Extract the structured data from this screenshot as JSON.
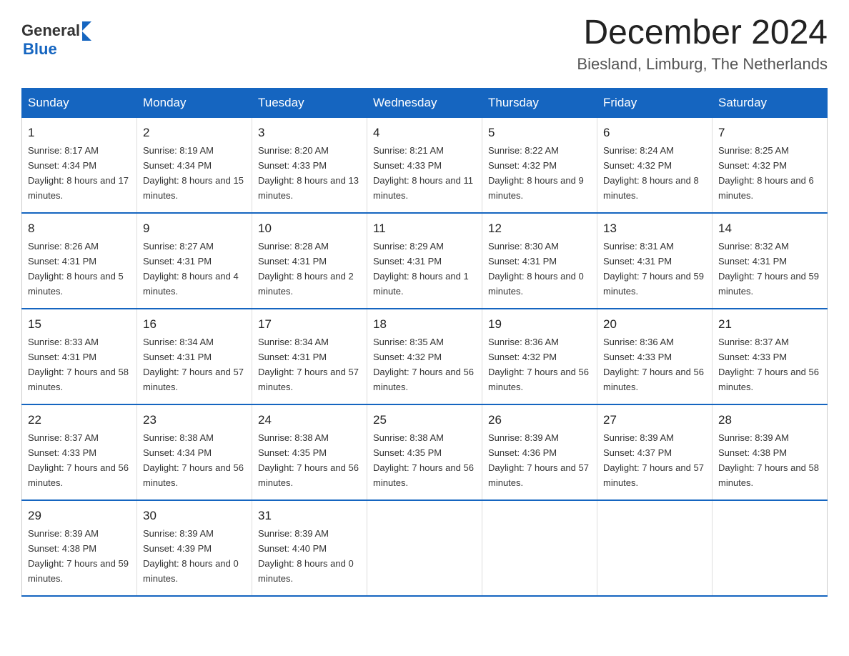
{
  "header": {
    "logo_general": "General",
    "logo_blue": "Blue",
    "month_title": "December 2024",
    "location": "Biesland, Limburg, The Netherlands"
  },
  "weekdays": [
    "Sunday",
    "Monday",
    "Tuesday",
    "Wednesday",
    "Thursday",
    "Friday",
    "Saturday"
  ],
  "weeks": [
    [
      {
        "day": "1",
        "sunrise": "8:17 AM",
        "sunset": "4:34 PM",
        "daylight": "8 hours and 17 minutes."
      },
      {
        "day": "2",
        "sunrise": "8:19 AM",
        "sunset": "4:34 PM",
        "daylight": "8 hours and 15 minutes."
      },
      {
        "day": "3",
        "sunrise": "8:20 AM",
        "sunset": "4:33 PM",
        "daylight": "8 hours and 13 minutes."
      },
      {
        "day": "4",
        "sunrise": "8:21 AM",
        "sunset": "4:33 PM",
        "daylight": "8 hours and 11 minutes."
      },
      {
        "day": "5",
        "sunrise": "8:22 AM",
        "sunset": "4:32 PM",
        "daylight": "8 hours and 9 minutes."
      },
      {
        "day": "6",
        "sunrise": "8:24 AM",
        "sunset": "4:32 PM",
        "daylight": "8 hours and 8 minutes."
      },
      {
        "day": "7",
        "sunrise": "8:25 AM",
        "sunset": "4:32 PM",
        "daylight": "8 hours and 6 minutes."
      }
    ],
    [
      {
        "day": "8",
        "sunrise": "8:26 AM",
        "sunset": "4:31 PM",
        "daylight": "8 hours and 5 minutes."
      },
      {
        "day": "9",
        "sunrise": "8:27 AM",
        "sunset": "4:31 PM",
        "daylight": "8 hours and 4 minutes."
      },
      {
        "day": "10",
        "sunrise": "8:28 AM",
        "sunset": "4:31 PM",
        "daylight": "8 hours and 2 minutes."
      },
      {
        "day": "11",
        "sunrise": "8:29 AM",
        "sunset": "4:31 PM",
        "daylight": "8 hours and 1 minute."
      },
      {
        "day": "12",
        "sunrise": "8:30 AM",
        "sunset": "4:31 PM",
        "daylight": "8 hours and 0 minutes."
      },
      {
        "day": "13",
        "sunrise": "8:31 AM",
        "sunset": "4:31 PM",
        "daylight": "7 hours and 59 minutes."
      },
      {
        "day": "14",
        "sunrise": "8:32 AM",
        "sunset": "4:31 PM",
        "daylight": "7 hours and 59 minutes."
      }
    ],
    [
      {
        "day": "15",
        "sunrise": "8:33 AM",
        "sunset": "4:31 PM",
        "daylight": "7 hours and 58 minutes."
      },
      {
        "day": "16",
        "sunrise": "8:34 AM",
        "sunset": "4:31 PM",
        "daylight": "7 hours and 57 minutes."
      },
      {
        "day": "17",
        "sunrise": "8:34 AM",
        "sunset": "4:31 PM",
        "daylight": "7 hours and 57 minutes."
      },
      {
        "day": "18",
        "sunrise": "8:35 AM",
        "sunset": "4:32 PM",
        "daylight": "7 hours and 56 minutes."
      },
      {
        "day": "19",
        "sunrise": "8:36 AM",
        "sunset": "4:32 PM",
        "daylight": "7 hours and 56 minutes."
      },
      {
        "day": "20",
        "sunrise": "8:36 AM",
        "sunset": "4:33 PM",
        "daylight": "7 hours and 56 minutes."
      },
      {
        "day": "21",
        "sunrise": "8:37 AM",
        "sunset": "4:33 PM",
        "daylight": "7 hours and 56 minutes."
      }
    ],
    [
      {
        "day": "22",
        "sunrise": "8:37 AM",
        "sunset": "4:33 PM",
        "daylight": "7 hours and 56 minutes."
      },
      {
        "day": "23",
        "sunrise": "8:38 AM",
        "sunset": "4:34 PM",
        "daylight": "7 hours and 56 minutes."
      },
      {
        "day": "24",
        "sunrise": "8:38 AM",
        "sunset": "4:35 PM",
        "daylight": "7 hours and 56 minutes."
      },
      {
        "day": "25",
        "sunrise": "8:38 AM",
        "sunset": "4:35 PM",
        "daylight": "7 hours and 56 minutes."
      },
      {
        "day": "26",
        "sunrise": "8:39 AM",
        "sunset": "4:36 PM",
        "daylight": "7 hours and 57 minutes."
      },
      {
        "day": "27",
        "sunrise": "8:39 AM",
        "sunset": "4:37 PM",
        "daylight": "7 hours and 57 minutes."
      },
      {
        "day": "28",
        "sunrise": "8:39 AM",
        "sunset": "4:38 PM",
        "daylight": "7 hours and 58 minutes."
      }
    ],
    [
      {
        "day": "29",
        "sunrise": "8:39 AM",
        "sunset": "4:38 PM",
        "daylight": "7 hours and 59 minutes."
      },
      {
        "day": "30",
        "sunrise": "8:39 AM",
        "sunset": "4:39 PM",
        "daylight": "8 hours and 0 minutes."
      },
      {
        "day": "31",
        "sunrise": "8:39 AM",
        "sunset": "4:40 PM",
        "daylight": "8 hours and 0 minutes."
      },
      null,
      null,
      null,
      null
    ]
  ]
}
